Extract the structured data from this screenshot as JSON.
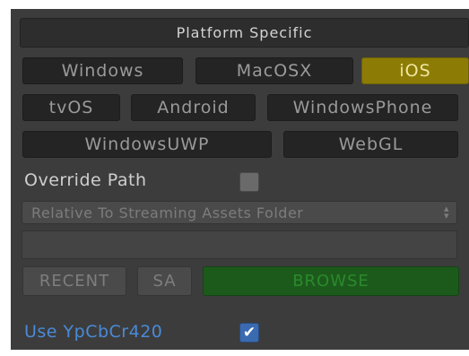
{
  "section": {
    "title": "Platform Specific"
  },
  "platforms": {
    "selected": "iOS",
    "row1": [
      "Windows",
      "MacOSX",
      "iOS"
    ],
    "row2": [
      "tvOS",
      "Android",
      "WindowsPhone"
    ],
    "row3": [
      "WindowsUWP",
      "WebGL"
    ]
  },
  "override_path": {
    "label": "Override Path",
    "checked": false
  },
  "path_location": {
    "selected": "Relative To Streaming Assets Folder"
  },
  "path_field": {
    "value": ""
  },
  "buttons": {
    "recent": "RECENT",
    "sa": "SA",
    "browse": "BROWSE"
  },
  "ycbcr": {
    "label": "Use YpCbCr420",
    "checked": true,
    "check_glyph": "✔"
  },
  "colors": {
    "panel_bg": "#3c3c3c",
    "selected_tab": "#8c7c05",
    "browse_button": "#1c5a1c",
    "link_blue": "#4a8ad8"
  }
}
